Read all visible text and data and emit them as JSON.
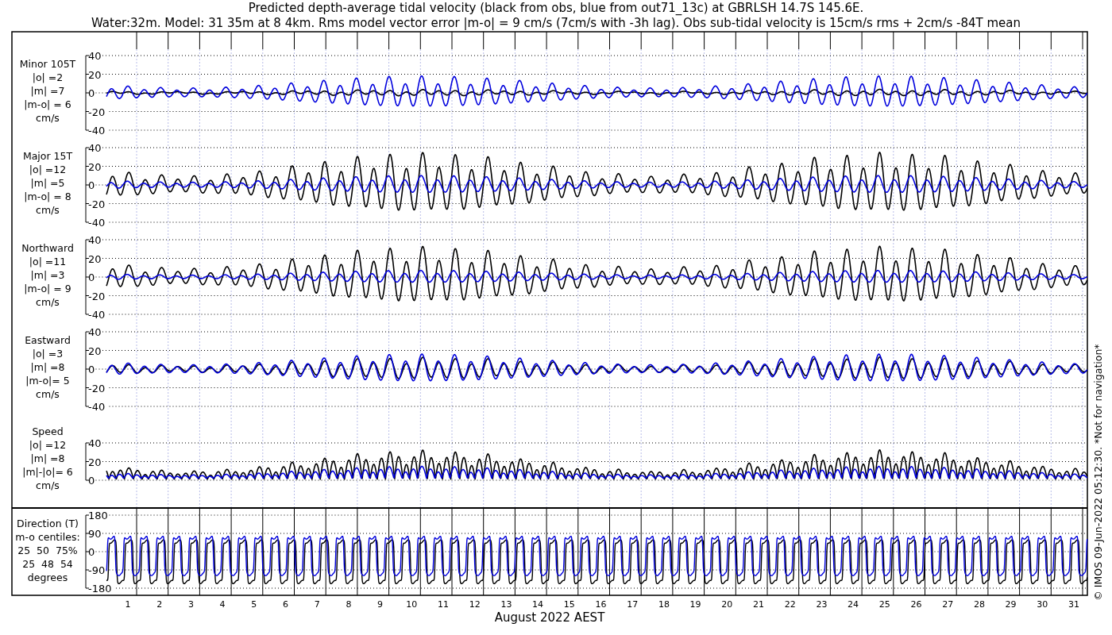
{
  "title_lines": [
    "Predicted depth-average tidal velocity (black from obs, blue from out71_13c) at GBRLSH 14.7S 145.6E.",
    "Water:32m. Model: 31 35m at 8 4km. Rms model vector error |m-o| = 9 cm/s (7cm/s with -3h lag). Obs sub-tidal velocity is 15cm/s rms + 2cm/s -84T mean"
  ],
  "panels": [
    {
      "kind": "velocity",
      "label_lines": [
        "Minor 105T",
        "|o| =2",
        "|m| =7",
        "|m-o| = 6",
        "cm/s"
      ],
      "yticks": [
        "40",
        "20",
        "0",
        "-20",
        "-40"
      ]
    },
    {
      "kind": "velocity",
      "label_lines": [
        "Major 15T",
        "|o| =12",
        "|m| =5",
        "|m-o| = 8",
        "cm/s"
      ],
      "yticks": [
        "40",
        "20",
        "0",
        "-20",
        "-40"
      ]
    },
    {
      "kind": "velocity",
      "label_lines": [
        "Northward",
        "|o| =11",
        "|m| =3",
        "|m-o| = 9",
        "cm/s"
      ],
      "yticks": [
        "40",
        "20",
        "0",
        "-20",
        "-40"
      ]
    },
    {
      "kind": "velocity",
      "label_lines": [
        "Eastward",
        "|o| =3",
        "|m| =8",
        "|m-o|= 5",
        "cm/s"
      ],
      "yticks": [
        "40",
        "20",
        "0",
        "-20",
        "-40"
      ]
    },
    {
      "kind": "speed",
      "label_lines": [
        "Speed",
        "|o| =12",
        "|m| =8",
        "|m|-|o|= 6",
        "cm/s"
      ],
      "yticks": [
        "40",
        "20",
        "0"
      ]
    },
    {
      "kind": "direction",
      "label_lines": [
        "Direction (T)",
        "m-o centiles:",
        "25  50  75%",
        "25  48  54",
        "degrees"
      ],
      "yticks": [
        "180",
        "90",
        "0",
        "-90",
        "-180"
      ]
    }
  ],
  "xtick_labels": [
    "1",
    "2",
    "3",
    "4",
    "5",
    "6",
    "7",
    "8",
    "9",
    "10",
    "11",
    "12",
    "13",
    "14",
    "15",
    "16",
    "17",
    "18",
    "19",
    "20",
    "21",
    "22",
    "23",
    "24",
    "25",
    "26",
    "27",
    "28",
    "29",
    "30",
    "31"
  ],
  "xlabel": "August 2022 AEST",
  "footnote": "© IMOS 09-Jun-2022 05:12:30. *Not for navigation*"
}
